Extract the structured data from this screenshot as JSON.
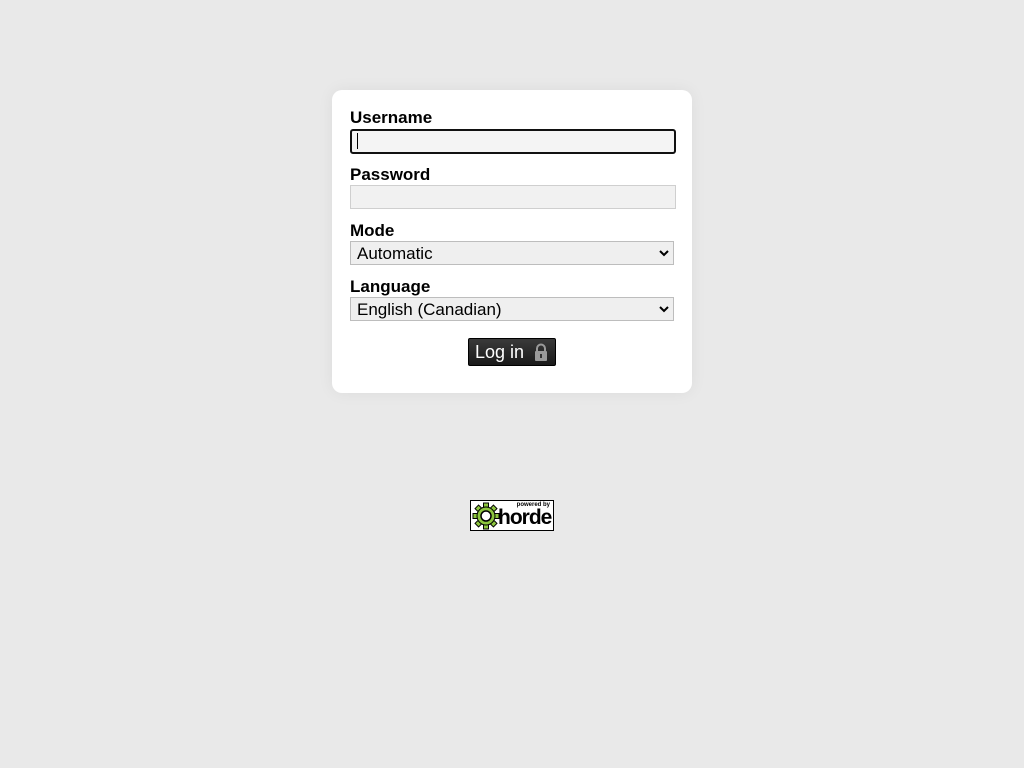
{
  "form": {
    "username": {
      "label": "Username",
      "value": ""
    },
    "password": {
      "label": "Password",
      "value": ""
    },
    "mode": {
      "label": "Mode",
      "selected": "Automatic"
    },
    "language": {
      "label": "Language",
      "selected": "English (Canadian)"
    },
    "login_button": {
      "label": "Log in",
      "icon": "lock-icon"
    }
  },
  "footer": {
    "badge_small_text": "powered by",
    "badge_brand": "horde",
    "badge_icon": "gear-icon",
    "badge_colors": {
      "gear": "#8dc63f",
      "outline": "#000000"
    }
  }
}
